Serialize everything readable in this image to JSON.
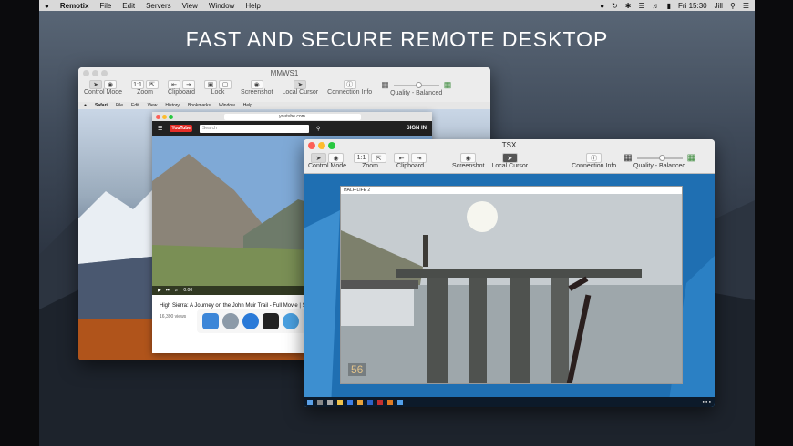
{
  "menubar": {
    "apple": "",
    "app_name": "Remotix",
    "items": [
      "File",
      "Edit",
      "Servers",
      "View",
      "Window",
      "Help"
    ],
    "clock": "Fri 15:30",
    "user": "Jill"
  },
  "headline": "FAST AND SECURE REMOTE DESKTOP",
  "window_back": {
    "title": "MMWS1",
    "toolbar": {
      "control_mode": "Control Mode",
      "zoom": "Zoom",
      "zoom_value": "1:1",
      "clipboard": "Clipboard",
      "lock": "Lock",
      "screenshot": "Screenshot",
      "local_cursor": "Local Cursor",
      "connection_info": "Connection Info",
      "quality": "Quality - Balanced"
    },
    "remote_menubar": [
      "Safari",
      "File",
      "Edit",
      "View",
      "History",
      "Bookmarks",
      "Window",
      "Help"
    ],
    "safari": {
      "url": "youtube.com",
      "yt_logo": "YouTube",
      "search_placeholder": "Search",
      "sign_in": "SIGN IN",
      "video_title": "High Sierra: A Journey on the John Muir Trail - Full Movie | Snap",
      "views": "16,390 views",
      "time": "0:00"
    }
  },
  "window_front": {
    "title": "TSX",
    "toolbar": {
      "control_mode": "Control Mode",
      "zoom": "Zoom",
      "zoom_value": "1:1",
      "clipboard": "Clipboard",
      "screenshot": "Screenshot",
      "local_cursor": "Local Cursor",
      "connection_info": "Connection Info",
      "quality": "Quality - Balanced"
    },
    "game_title": "HALF-LIFE 2",
    "ammo": "56"
  },
  "quality_level_back": 0.55,
  "quality_level_front": 0.55,
  "colors": {
    "close": "#fc5f57",
    "minimize": "#fdbc2e",
    "zoom": "#28c840",
    "inactive_light": "#cfcfcf"
  }
}
